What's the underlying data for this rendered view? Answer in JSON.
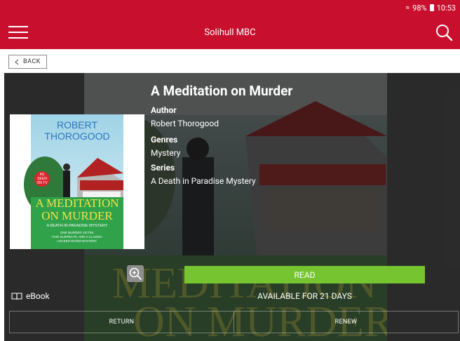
{
  "status_bar": {
    "battery": "98%",
    "time": "10:53"
  },
  "app_bar": {
    "title": "Solihull MBC",
    "menu_icon": "hamburger-menu-icon",
    "search_icon": "search-icon"
  },
  "nav": {
    "back_label": "BACK"
  },
  "book": {
    "title": "A Meditation on Murder",
    "author_label": "Author",
    "author": "Robert Thorogood",
    "genres_label": "Genres",
    "genres": "Mystery",
    "series_label": "Series",
    "series": "A Death in Paradise Mystery",
    "format": "eBook",
    "availability": "AVAILABLE FOR 21 DAYS"
  },
  "cover": {
    "author_line_1": "ROBERT",
    "author_line_2": "THOROGOOD",
    "title_line_1": "A MEDITATION",
    "title_line_2": "ON MURDER",
    "series_line": "A DEATH IN PARADISE MYSTERY",
    "tagline_1": "ONE MURDER VICTIM.",
    "tagline_2": "FIVE SUSPECTS. AND A CLASSIC",
    "tagline_3": "LOCKED ROOM MYSTERY.",
    "badge_1": "AS",
    "badge_2": "SEEN",
    "badge_3": "ON TV"
  },
  "actions": {
    "read": "READ",
    "return": "RETURN",
    "renew": "RENEW"
  },
  "colors": {
    "brand_red": "#c8102e",
    "read_green": "#77c431"
  }
}
